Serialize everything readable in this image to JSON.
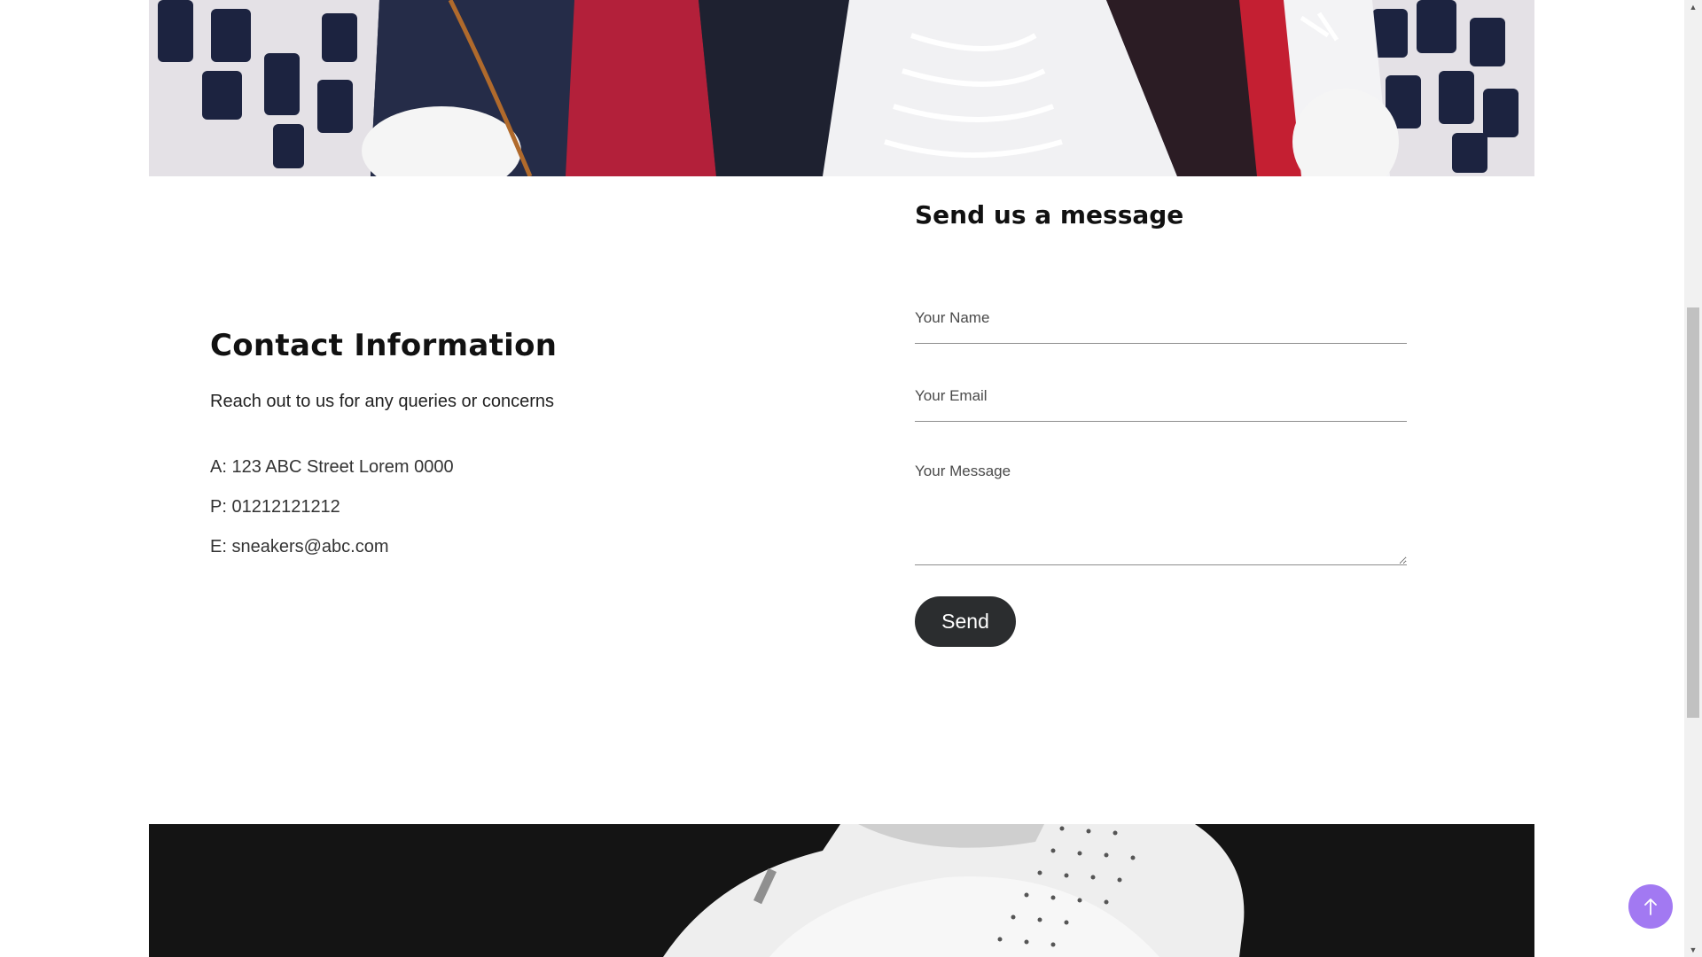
{
  "hero_top": {
    "icon": "sneakers-photo"
  },
  "contact": {
    "title": "Contact Information",
    "subtitle": "Reach out to us for any queries or concerns",
    "address": "A: 123 ABC Street Lorem 0000",
    "phone": "P: 01212121212",
    "email": "E: sneakers@abc.com"
  },
  "form": {
    "title": "Send us a message",
    "name_placeholder": "Your Name",
    "email_placeholder": "Your Email",
    "message_placeholder": "Your Message",
    "send_label": "Send"
  },
  "hero_bottom": {
    "icon": "white-sneaker-photo"
  },
  "back_to_top": {
    "icon": "arrow-up-icon",
    "color": "#a279f2"
  },
  "colors": {
    "button_bg": "#2b2d2f",
    "bottom_banner_bg": "#141414"
  }
}
